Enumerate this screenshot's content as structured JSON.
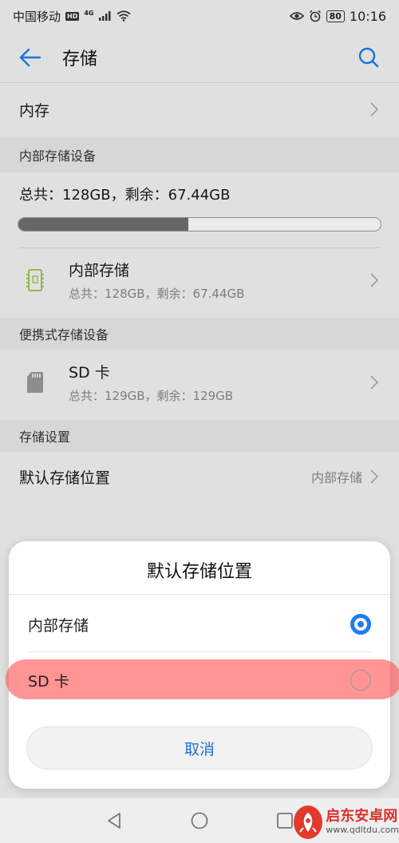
{
  "status_bar": {
    "carrier": "中国移动",
    "hd": "HD",
    "network": "4G",
    "battery": "80",
    "time": "10:16"
  },
  "app_bar": {
    "title": "存储",
    "back_icon": "arrow-left-icon",
    "search_icon": "search-icon"
  },
  "memory_row": {
    "label": "内存"
  },
  "internal_section": {
    "header": "内部存储设备",
    "summary": "总共：128GB，剩余：67.44GB",
    "used_fraction": 0.47,
    "device": {
      "name": "内部存储",
      "details": "总共：128GB，剩余：67.44GB",
      "icon": "internal-storage-icon"
    }
  },
  "portable_section": {
    "header": "便携式存储设备",
    "device": {
      "name": "SD 卡",
      "details": "总共：129GB，剩余：129GB",
      "icon": "sd-card-icon"
    }
  },
  "settings_section": {
    "header": "存储设置",
    "default_location": {
      "label": "默认存储位置",
      "value": "内部存储"
    }
  },
  "dialog": {
    "title": "默认存储位置",
    "options": [
      {
        "label": "内部存储",
        "selected": true
      },
      {
        "label": "SD 卡",
        "selected": false
      }
    ],
    "cancel": "取消"
  },
  "watermark": {
    "name": "启东安卓网",
    "url": "www.qdltdu.com"
  },
  "colors": {
    "accent": "#1e7cf0",
    "highlight": "#ff5a5a",
    "device_icon_green": "#8cc63f"
  }
}
